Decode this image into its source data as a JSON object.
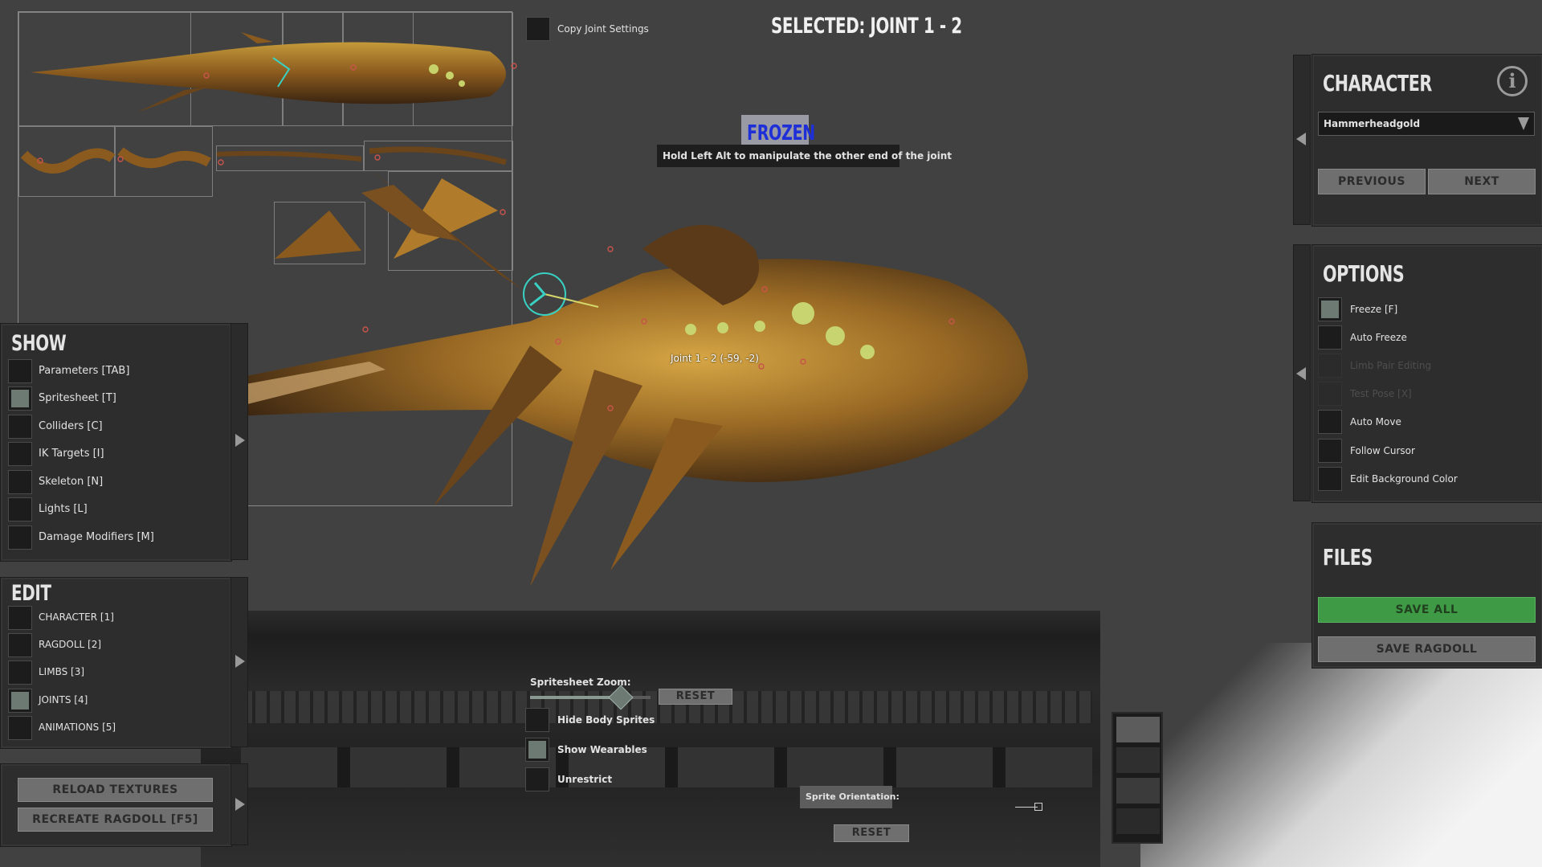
{
  "header": {
    "copy_joint_label": "Copy Joint Settings",
    "selected_title": "SELECTED: JOINT 1 - 2"
  },
  "overlay": {
    "frozen_badge": "FROZEN",
    "hint_text": "Hold Left Alt to manipulate the other end of the joint",
    "joint_label": "Joint 1 - 2 (-59, -2)"
  },
  "show_panel": {
    "title": "SHOW",
    "items": [
      {
        "label": "Parameters [TAB]",
        "checked": false
      },
      {
        "label": "Spritesheet [T]",
        "checked": true
      },
      {
        "label": "Colliders [C]",
        "checked": false
      },
      {
        "label": "IK Targets [I]",
        "checked": false
      },
      {
        "label": "Skeleton [N]",
        "checked": false
      },
      {
        "label": "Lights [L]",
        "checked": false
      },
      {
        "label": "Damage Modifiers [M]",
        "checked": false
      }
    ]
  },
  "edit_panel": {
    "title": "EDIT",
    "items": [
      {
        "label": "CHARACTER [1]",
        "checked": false
      },
      {
        "label": "RAGDOLL [2]",
        "checked": false
      },
      {
        "label": "LIMBS [3]",
        "checked": false
      },
      {
        "label": "JOINTS [4]",
        "checked": true
      },
      {
        "label": "ANIMATIONS [5]",
        "checked": false
      }
    ]
  },
  "actions_panel": {
    "reload_textures": "RELOAD TEXTURES",
    "recreate_ragdoll": "RECREATE RAGDOLL [F5]"
  },
  "character_panel": {
    "title": "CHARACTER",
    "info_icon": "i",
    "selected_character": "Hammerheadgold",
    "previous": "PREVIOUS",
    "next": "NEXT"
  },
  "options_panel": {
    "title": "OPTIONS",
    "items": [
      {
        "label": "Freeze [F]",
        "checked": true,
        "enabled": true
      },
      {
        "label": "Auto Freeze",
        "checked": false,
        "enabled": true
      },
      {
        "label": "Limb Pair Editing",
        "checked": false,
        "enabled": false
      },
      {
        "label": "Test Pose [X]",
        "checked": false,
        "enabled": false
      },
      {
        "label": "Auto Move",
        "checked": false,
        "enabled": true
      },
      {
        "label": "Follow Cursor",
        "checked": false,
        "enabled": true
      },
      {
        "label": "Edit Background Color",
        "checked": false,
        "enabled": true
      }
    ]
  },
  "files_panel": {
    "title": "FILES",
    "save_all": "SAVE ALL",
    "save_ragdoll": "SAVE RAGDOLL"
  },
  "bottom_controls": {
    "spritesheet_zoom_label": "Spritesheet Zoom:",
    "zoom_reset": "RESET",
    "hide_body_sprites": "Hide Body Sprites",
    "show_wearables": "Show Wearables",
    "unrestrict": "Unrestrict",
    "sprite_orientation_label": "Sprite Orientation:",
    "orientation_reset": "RESET",
    "zoom_level": 0.75
  },
  "colors": {
    "background": "#414141",
    "panel": "#2c2d2c",
    "save_all_green": "#3f9a45",
    "frozen_text": "#1f2fd8",
    "creature_gold": "#b98a2e"
  }
}
